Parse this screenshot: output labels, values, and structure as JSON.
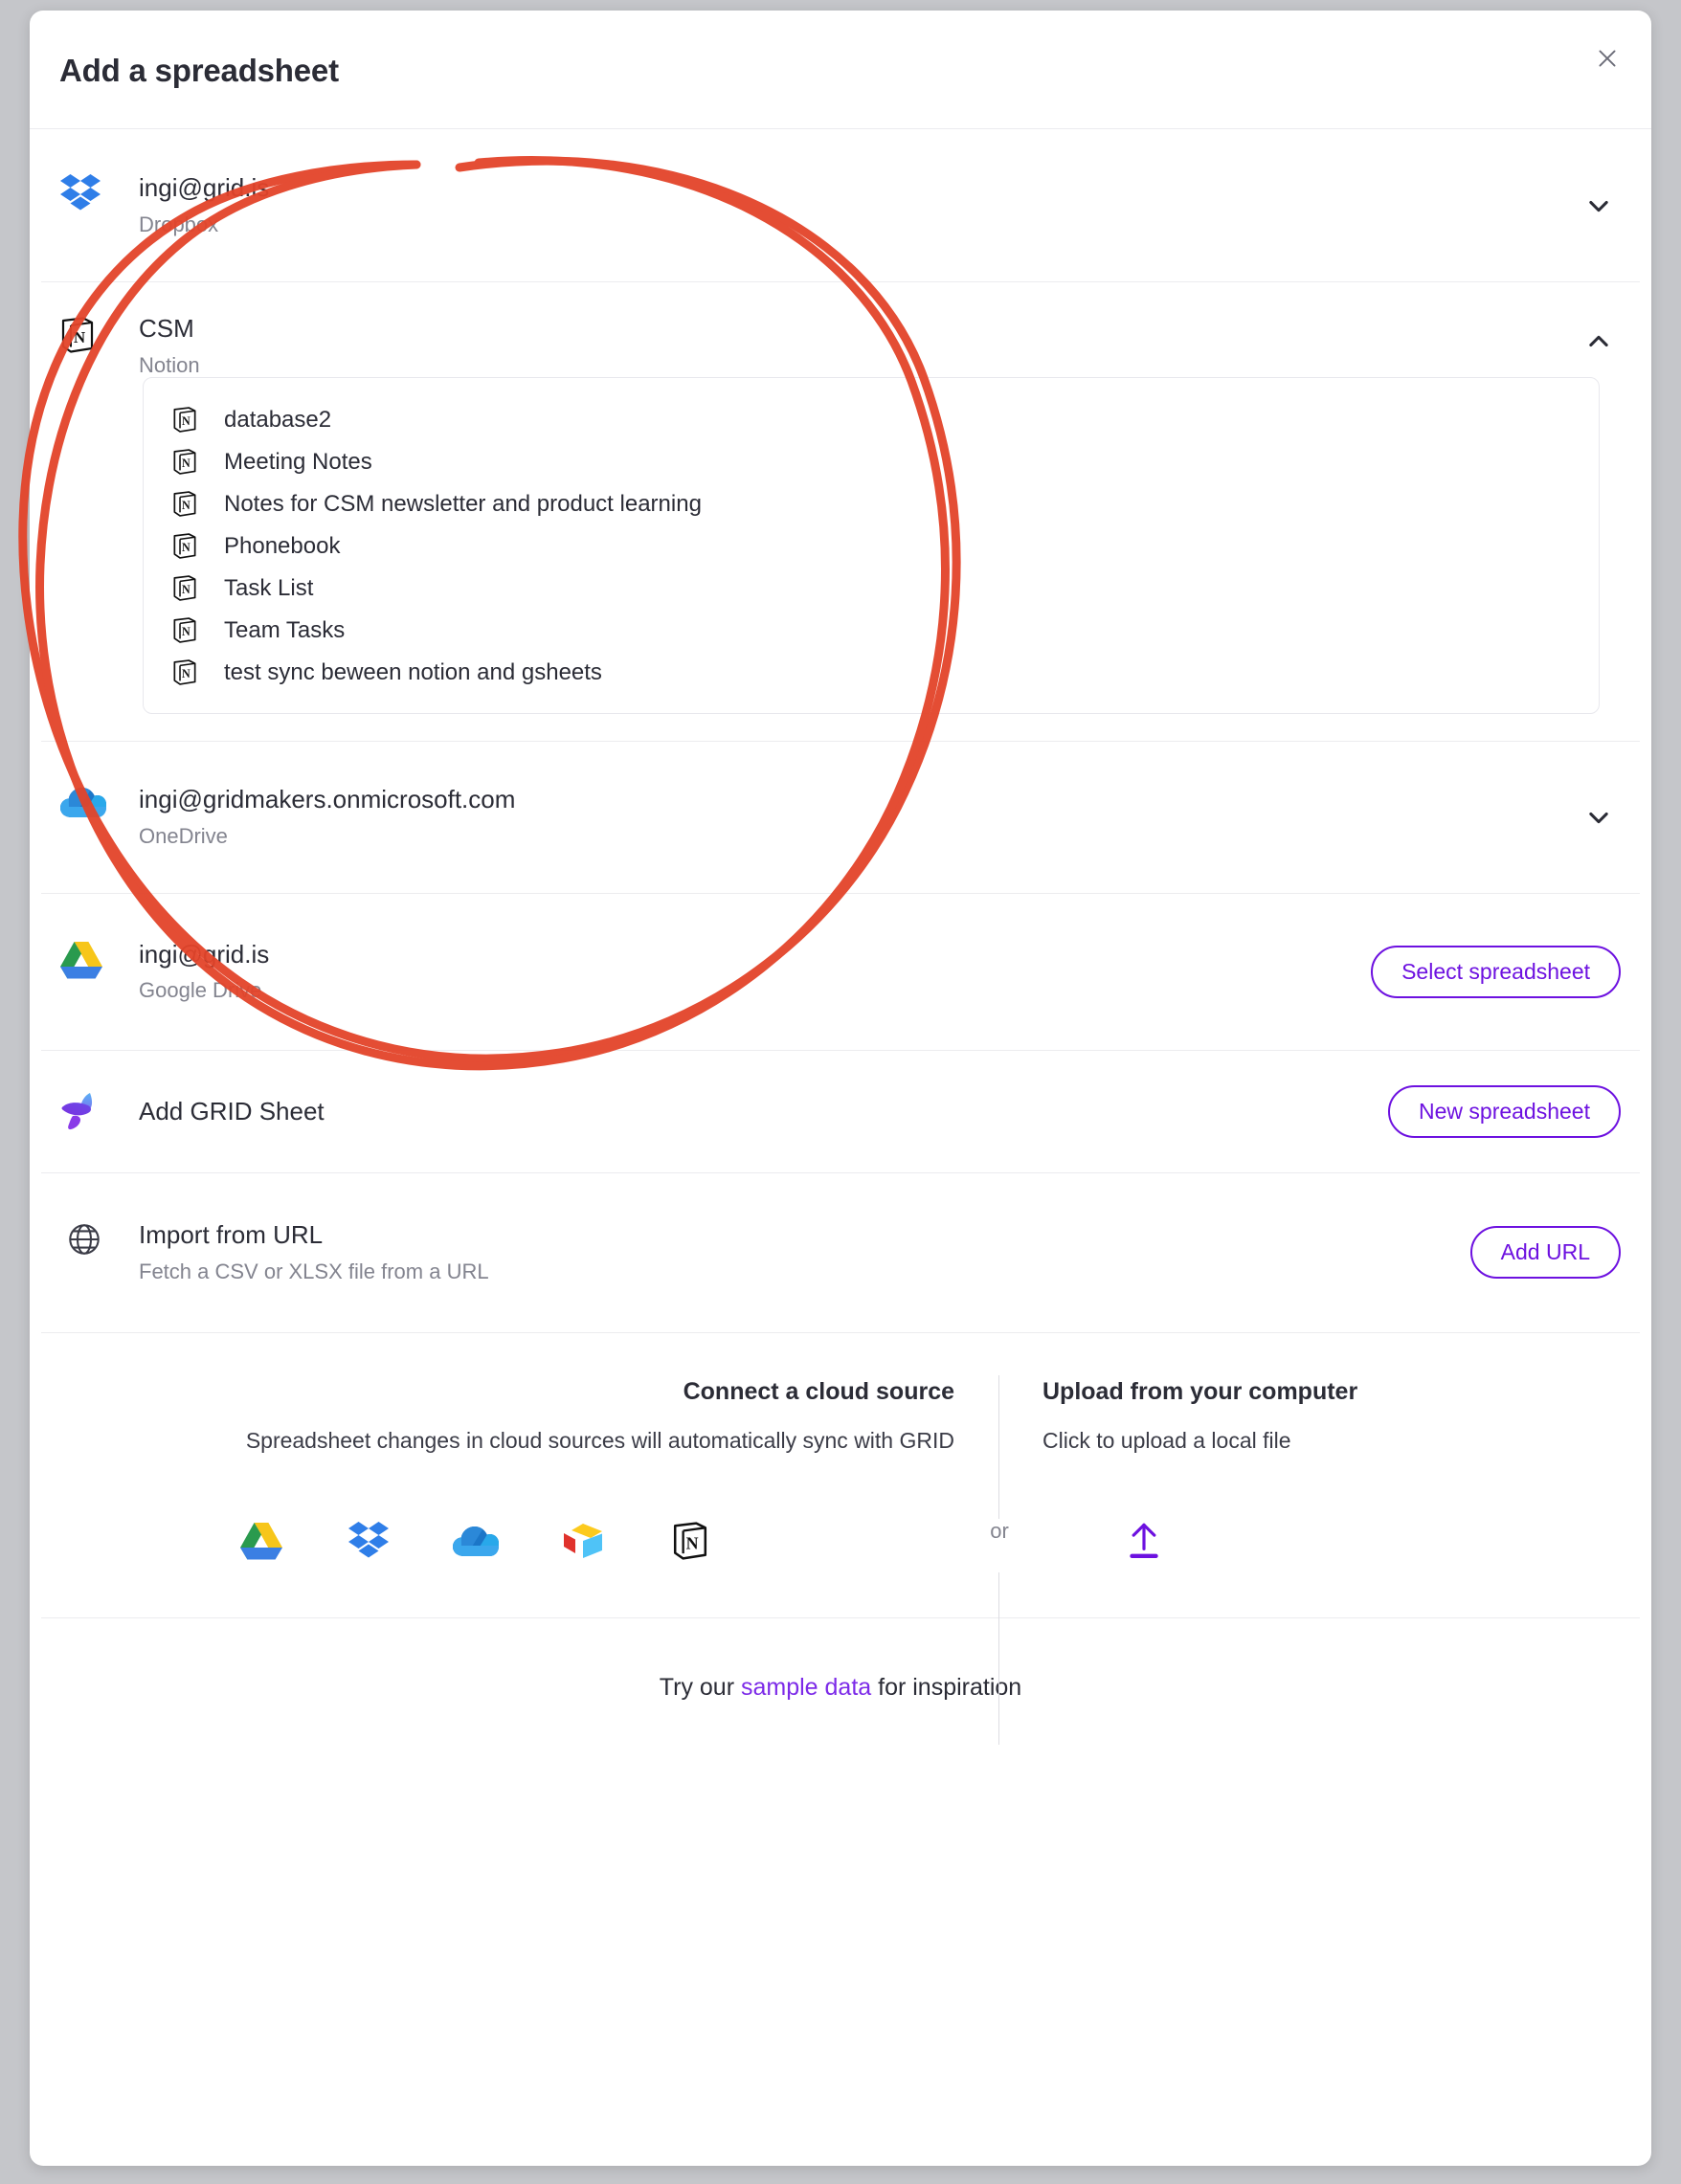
{
  "dialog": {
    "title": "Add a spreadsheet",
    "close_icon": "close-icon"
  },
  "sources": [
    {
      "icon": "dropbox-icon",
      "title": "ingi@grid.is",
      "subtitle": "Dropbox",
      "control": "chevron-down",
      "expanded": false
    },
    {
      "icon": "notion-icon",
      "title": "CSM",
      "subtitle": "Notion",
      "control": "chevron-up",
      "expanded": true
    },
    {
      "icon": "onedrive-icon",
      "title": "ingi@gridmakers.onmicrosoft.com",
      "subtitle": "OneDrive",
      "control": "chevron-down",
      "expanded": false
    },
    {
      "icon": "google-drive-icon",
      "title": "ingi@grid.is",
      "subtitle": "Google Drive",
      "control": "button",
      "button_label": "Select spreadsheet"
    },
    {
      "icon": "grid-logo-icon",
      "title": "Add GRID Sheet",
      "subtitle": "",
      "control": "button",
      "button_label": "New spreadsheet"
    },
    {
      "icon": "globe-icon",
      "title": "Import from URL",
      "subtitle": "Fetch a CSV or XLSX file from a URL",
      "control": "button",
      "button_label": "Add URL"
    }
  ],
  "notion_documents": [
    {
      "icon": "notion-icon",
      "label": "database2"
    },
    {
      "icon": "notion-icon",
      "label": "Meeting Notes"
    },
    {
      "icon": "notion-icon",
      "label": "Notes for CSM newsletter and product learning"
    },
    {
      "icon": "notion-icon",
      "label": "Phonebook"
    },
    {
      "icon": "notion-icon",
      "label": "Task List"
    },
    {
      "icon": "notion-icon",
      "label": "Team Tasks"
    },
    {
      "icon": "notion-icon",
      "label": "test sync beween notion and gsheets"
    }
  ],
  "info": {
    "cloud": {
      "heading": "Connect a cloud source",
      "description": "Spreadsheet changes in cloud sources will automatically sync with GRID",
      "icons": [
        "google-drive-icon",
        "dropbox-icon",
        "onedrive-icon",
        "airtable-icon",
        "notion-icon"
      ]
    },
    "upload": {
      "heading": "Upload from your computer",
      "description": "Click to upload a local file",
      "icon": "upload-icon"
    },
    "or_label": "or"
  },
  "bottom": {
    "prefix": "Try our ",
    "link": "sample data",
    "suffix": " for inspiration"
  },
  "colors": {
    "accent": "#6d11e0",
    "link": "#7c2ae8",
    "text": "#2b2c36",
    "muted": "#83848f",
    "annotation": "#e3442a",
    "page_bg": "#c5c6ca"
  },
  "annotation": {
    "shape": "hand-drawn-circle",
    "color": "#e3442a"
  }
}
